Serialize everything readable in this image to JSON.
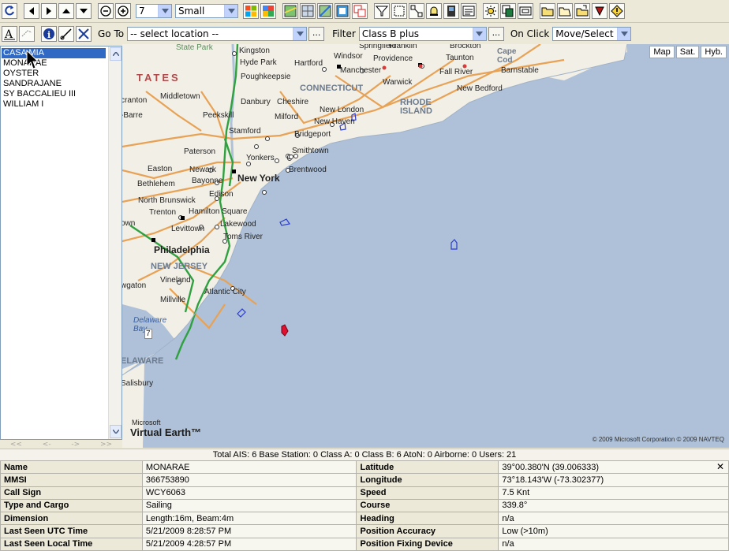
{
  "toolbar": {
    "zoom_level": "7",
    "icon_size": "Small",
    "goto_label": "Go To",
    "goto_value": "-- select location --",
    "filter_label": "Filter",
    "filter_value": "Class B plus",
    "onclick_label": "On Click",
    "onclick_value": "Move/Select",
    "more_label": "..."
  },
  "sidebar": {
    "vessels": [
      "CASA MIA",
      "MONARAE",
      "OYSTER",
      "SANDRAJANE",
      "SY BACCALIEU III",
      "WILLIAM I"
    ],
    "selected_index": 0,
    "pager": [
      "<<",
      "<-",
      "->",
      ">>"
    ]
  },
  "map": {
    "type_buttons": [
      "Map",
      "Sat.",
      "Hyb."
    ],
    "microsoft": "Microsoft",
    "virtual_earth": "Virtual Earth™",
    "copyright": "© 2009 Microsoft Corporation   © 2009 NAVTEQ",
    "labels": {
      "state_park": "State Park",
      "kingston": "Kingston",
      "springfield": "Springfield",
      "franklin": "Franklin",
      "brockton": "Brockton",
      "cape_cod": "Cape\nCod",
      "hyde_park": "Hyde Park",
      "hartford": "Hartford",
      "windsor": "Windsor",
      "providence": "Providence",
      "taunton": "Taunton",
      "poughkeepsie": "Poughkeepsie",
      "manchester": "Manchester",
      "fall_river": "Fall River",
      "barnstable": "Barnstable",
      "tates": "TATES",
      "warwick": "Warwick",
      "middletown": "Middletown",
      "connecticut": "CONNECTICUT",
      "new_bedford": "New Bedford",
      "cranton": "cranton",
      "danbury": "Danbury",
      "cheshire": "Cheshire",
      "rhode_island": "RHODE\nISLAND",
      "new_london": "New London",
      "barre": "-Barre",
      "peekskill": "Peekskill",
      "milford": "Milford",
      "new_haven": "New Haven",
      "stamford": "Stamford",
      "bridgeport": "Bridgeport",
      "smithtown": "Smithtown",
      "paterson": "Paterson",
      "yonkers": "Yonkers",
      "easton": "Easton",
      "newark": "Newark",
      "brentwood": "Brentwood",
      "bethlehem": "Bethlehem",
      "bayonne": "Bayonne",
      "new_york": "New York",
      "edison": "Edison",
      "north_brunswick": "North Brunswick",
      "trenton": "Trenton",
      "hamilton_square": "Hamilton Square",
      "own": "own",
      "levittown": "Levittown",
      "lakewood": "Lakewood",
      "toms_river": "Toms River",
      "philadelphia": "Philadelphia",
      "new_jersey": "NEW JERSEY",
      "wgaton": "wgaton",
      "vineland": "Vineland",
      "atlantic_city": "Atlantic City",
      "millville": "Millville",
      "delaware_bay": "Delaware\nBay",
      "elaware": "ELAWARE",
      "salisbury": "Salisbury",
      "route_7": "7"
    }
  },
  "status": {
    "summary": "Total AIS: 6 Base Station: 0 Class A: 0 Class B: 6 AtoN: 0 Airborne: 0 Users: 21"
  },
  "details": {
    "rows": [
      {
        "k1": "Name",
        "v1": "MONARAE",
        "k2": "Latitude",
        "v2": "39°00.380'N (39.006333)"
      },
      {
        "k1": "MMSI",
        "v1": "366753890",
        "k2": "Longitude",
        "v2": "73°18.143'W (-73.302377)"
      },
      {
        "k1": "Call Sign",
        "v1": "WCY6063",
        "k2": "Speed",
        "v2": "7.5 Knt"
      },
      {
        "k1": "Type and Cargo",
        "v1": "Sailing",
        "k2": "Course",
        "v2": "339.8°"
      },
      {
        "k1": "Dimension",
        "v1": "Length:16m, Beam:4m",
        "k2": "Heading",
        "v2": "n/a"
      },
      {
        "k1": "Last Seen UTC Time",
        "v1": "5/21/2009 8:28:57 PM",
        "k2": "Position Accuracy",
        "v2": "Low (>10m)"
      },
      {
        "k1": "Last Seen Local Time",
        "v1": "5/21/2009 4:28:57 PM",
        "k2": "Position Fixing Device",
        "v2": "n/a"
      }
    ],
    "close_label": "✕"
  },
  "colors": {
    "land": "#f2efe6",
    "water": "#aec1d9",
    "selected": "#316ac5",
    "vessel_outline": "#2a3bd1",
    "vessel_selected": "#e0102f"
  }
}
